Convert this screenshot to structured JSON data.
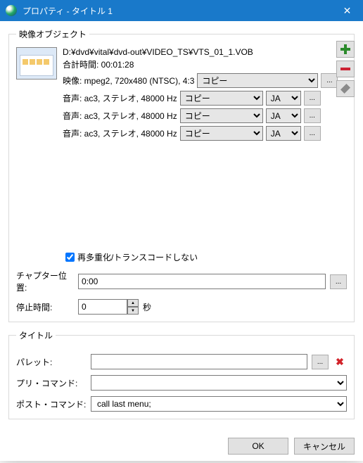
{
  "window": {
    "title": "プロパティ - タイトル 1",
    "close": "✕"
  },
  "video_group": {
    "legend": "映像オブジェクト",
    "path": "D:¥dvd¥vital¥dvd-out¥VIDEO_TS¥VTS_01_1.VOB",
    "duration_label": "合計時間: 00:01:28",
    "video_label": "映像: mpeg2, 720x480 (NTSC), 4:3",
    "video_combo": "コピー",
    "audio1_label": "音声: ac3, ステレオ, 48000 Hz",
    "audio1_combo": "コピー",
    "audio1_lang": "JA",
    "audio2_label": "音声: ac3, ステレオ, 48000 Hz",
    "audio2_combo": "コピー",
    "audio2_lang": "JA",
    "audio3_label": "音声: ac3, ステレオ, 48000 Hz",
    "audio3_combo": "コピー",
    "audio3_lang": "JA",
    "ellipsis": "...",
    "remux_checkbox": "再多重化/トランスコードしない",
    "chapter_label": "チャプター位置:",
    "chapter_value": "0:00",
    "pause_label": "停止時間:",
    "pause_value": "0",
    "pause_unit": "秒"
  },
  "title_group": {
    "legend": "タイトル",
    "palette_label": "パレット:",
    "palette_value": "",
    "pre_label": "プリ・コマンド:",
    "pre_value": "",
    "post_label": "ポスト・コマンド:",
    "post_value": "call last menu;",
    "ellipsis": "...",
    "delete": "✖"
  },
  "buttons": {
    "ok": "OK",
    "cancel": "キャンセル"
  }
}
